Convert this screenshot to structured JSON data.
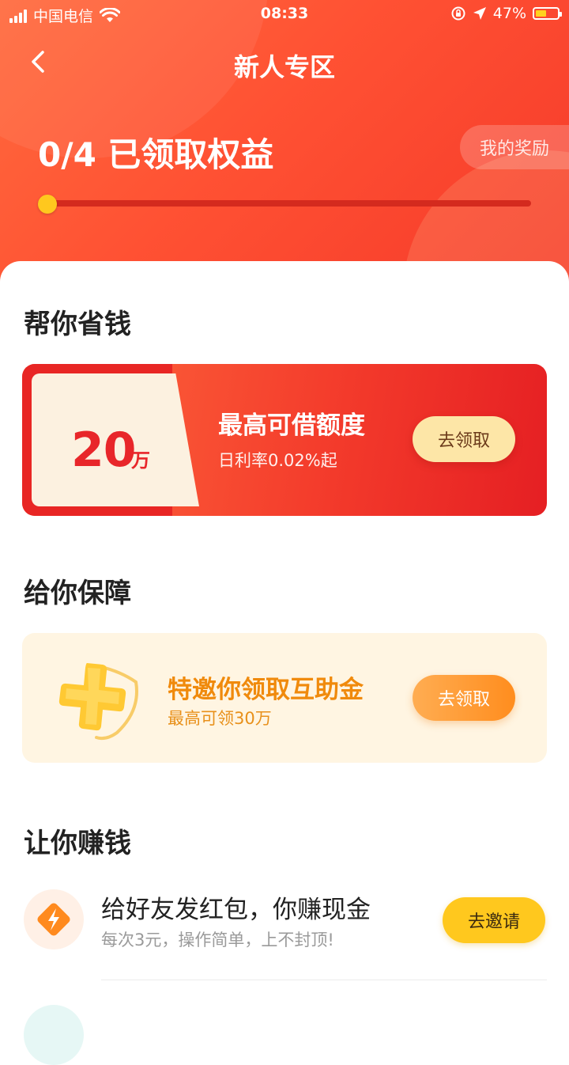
{
  "status_bar": {
    "carrier": "中国电信",
    "time": "08:33",
    "battery_percent": "47%"
  },
  "header": {
    "title": "新人专区",
    "progress_text": "0/4 已领取权益",
    "my_rewards_label": "我的奖励",
    "progress": {
      "claimed": 0,
      "total": 4
    }
  },
  "save_money": {
    "section_title": "帮你省钱",
    "amount": "20",
    "amount_unit": "万",
    "title": "最高可借额度",
    "subtitle": "日利率0.02%起",
    "button_label": "去领取"
  },
  "protection": {
    "section_title": "给你保障",
    "title": "特邀你领取互助金",
    "subtitle": "最高可领30万",
    "button_label": "去领取"
  },
  "earn_money": {
    "section_title": "让你赚钱",
    "items": [
      {
        "title": "给好友发红包，你赚现金",
        "subtitle": "每次3元，操作简单，上不封顶!",
        "button_label": "去邀请",
        "icon": "lightning-bolt-icon"
      }
    ]
  },
  "colors": {
    "header_red": "#ff5133",
    "accent_yellow": "#ffc81e",
    "accent_orange": "#ff8d1e",
    "amount_red": "#e8262a"
  }
}
